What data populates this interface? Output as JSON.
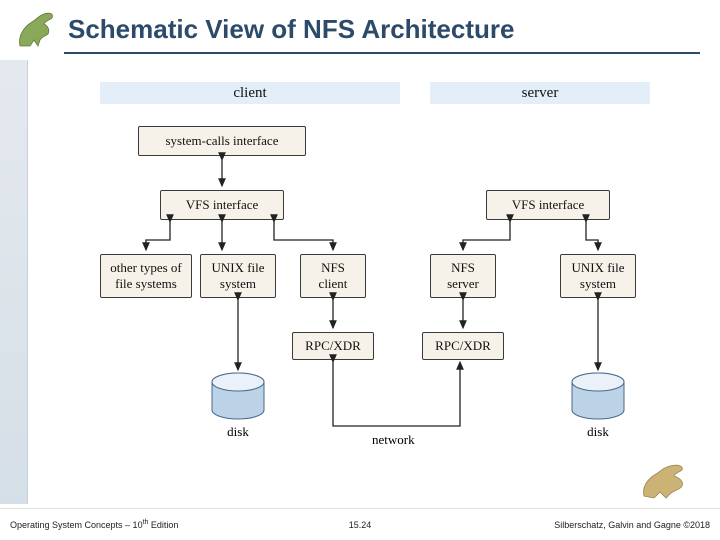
{
  "title": "Schematic View of NFS Architecture",
  "footer": {
    "left_a": "Operating System Concepts – 10",
    "left_sup": "th",
    "left_b": " Edition",
    "center": "15.24",
    "right": "Silberschatz, Galvin and Gagne ©2018"
  },
  "headers": {
    "client": "client",
    "server": "server"
  },
  "boxes": {
    "sci": "system-calls interface",
    "vfs_c": "VFS interface",
    "vfs_s": "VFS interface",
    "other_fs": "other types of\nfile systems",
    "unix_c": "UNIX file\nsystem",
    "nfs_client": "NFS\nclient",
    "nfs_server": "NFS\nserver",
    "unix_s": "UNIX file\nsystem",
    "rpc_c": "RPC/XDR",
    "rpc_s": "RPC/XDR"
  },
  "labels": {
    "disk_c": "disk",
    "disk_s": "disk",
    "network": "network"
  }
}
